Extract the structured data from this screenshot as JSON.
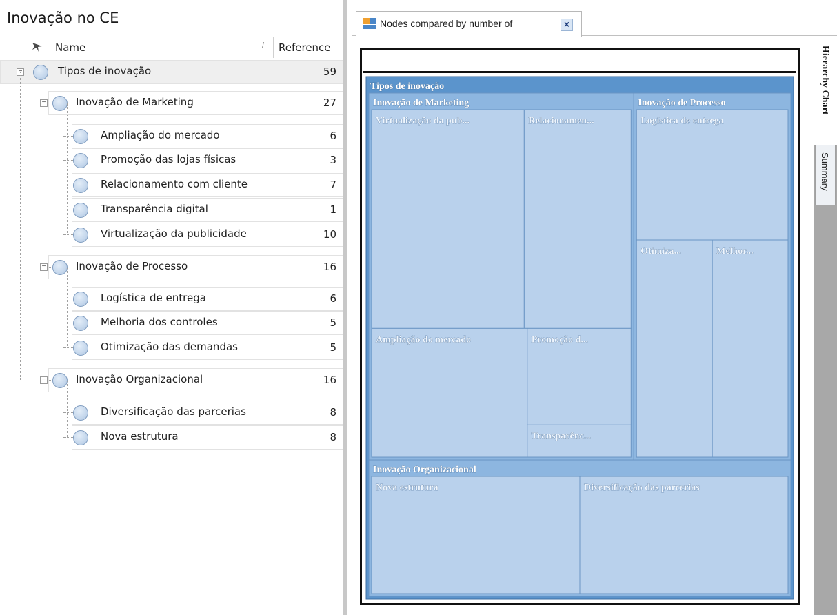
{
  "panel": {
    "title": "Inovação no CE"
  },
  "columns": {
    "name": "Name",
    "reference": "Reference",
    "sort_indicator": "/"
  },
  "tree": [
    {
      "label": "Tipos de inovação",
      "ref": "59",
      "level": 0,
      "selected": true
    },
    {
      "label": "Inovação de Marketing",
      "ref": "27",
      "level": 1
    },
    {
      "label": "Ampliação do mercado",
      "ref": "6",
      "level": 2
    },
    {
      "label": "Promoção das lojas físicas",
      "ref": "3",
      "level": 2
    },
    {
      "label": "Relacionamento com cliente",
      "ref": "7",
      "level": 2
    },
    {
      "label": "Transparência digital",
      "ref": "1",
      "level": 2
    },
    {
      "label": "Virtualização da publicidade",
      "ref": "10",
      "level": 2
    },
    {
      "label": "Inovação de Processo",
      "ref": "16",
      "level": 1
    },
    {
      "label": "Logística de entrega",
      "ref": "6",
      "level": 2
    },
    {
      "label": "Melhoria dos controles",
      "ref": "5",
      "level": 2
    },
    {
      "label": "Otimização das demandas",
      "ref": "5",
      "level": 2
    },
    {
      "label": "Inovação Organizacional",
      "ref": "16",
      "level": 1
    },
    {
      "label": "Diversificação das parcerias",
      "ref": "8",
      "level": 2
    },
    {
      "label": "Nova estrutura",
      "ref": "8",
      "level": 2
    }
  ],
  "tab": {
    "label": "Nodes compared by number of",
    "close": "×"
  },
  "side_tabs": {
    "hierarchy": "Hierarchy Chart",
    "summary": "Summary"
  },
  "colors": {
    "treemap_root": "#5b94cc",
    "treemap_group": "#8db6e0",
    "treemap_leaf": "#b9d1ec",
    "node_circle": "#c5d7ec"
  },
  "chart_data": {
    "type": "treemap",
    "root": {
      "name": "Tipos de inovação",
      "value": 59,
      "children": [
        {
          "name": "Inovação de Marketing",
          "value": 27,
          "children": [
            {
              "name": "Virtualização da pub...",
              "value": 10
            },
            {
              "name": "Relacionamen...",
              "value": 7
            },
            {
              "name": "Ampliação do mercado",
              "value": 6
            },
            {
              "name": "Promoção d...",
              "value": 3
            },
            {
              "name": "Transparênc...",
              "value": 1
            }
          ]
        },
        {
          "name": "Inovação de Processo",
          "value": 16,
          "children": [
            {
              "name": "Logística de entrega",
              "value": 6
            },
            {
              "name": "Otimiza...",
              "value": 5
            },
            {
              "name": "Melhor...",
              "value": 5
            }
          ]
        },
        {
          "name": "Inovação Organizacional",
          "value": 16,
          "children": [
            {
              "name": "Nova estrutura",
              "value": 8
            },
            {
              "name": "Diversificação das parcerias",
              "value": 8
            }
          ]
        }
      ]
    }
  }
}
